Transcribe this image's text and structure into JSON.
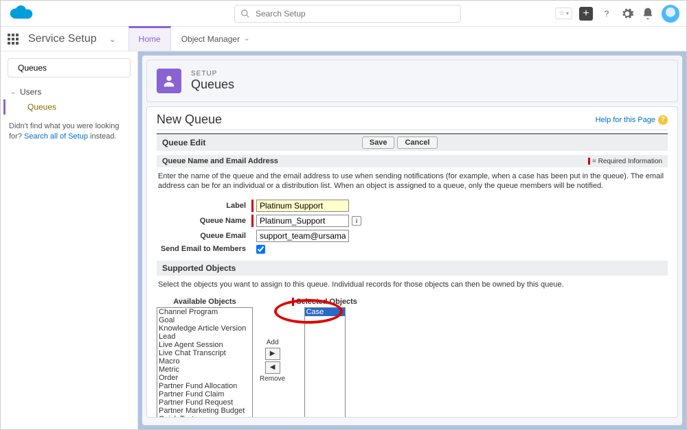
{
  "topbar": {
    "search_placeholder": "Search Setup"
  },
  "nav": {
    "app_name": "Service Setup",
    "tabs": [
      {
        "label": "Home",
        "active": true
      },
      {
        "label": "Object Manager",
        "active": false
      }
    ]
  },
  "sidebar": {
    "search_value": "Queues",
    "tree_parent": "Users",
    "tree_child": "Queues",
    "help_prefix": "Didn't find what you were looking for? ",
    "help_link": "Search all of Setup",
    "help_suffix": " instead."
  },
  "header": {
    "sup": "SETUP",
    "title": "Queues"
  },
  "page": {
    "title": "New Queue",
    "help_label": "Help for this Page",
    "edit_block_title": "Queue Edit",
    "save_btn": "Save",
    "cancel_btn": "Cancel",
    "name_section_title": "Queue Name and Email Address",
    "required_info": "= Required Information",
    "desc": "Enter the name of the queue and the email address to use when sending notifications (for example, when a case has been put in the queue). The email address can be for an individual or a distribution list. When an object is assigned to a queue, only the queue members will be notified.",
    "fields": {
      "label_label": "Label",
      "label_value": "Platinum Support",
      "qname_label": "Queue Name",
      "qname_value": "Platinum_Support",
      "qemail_label": "Queue Email",
      "qemail_value": "support_team@ursamajorso",
      "send_label": "Send Email to Members"
    },
    "supported_title": "Supported Objects",
    "supported_desc": "Select the objects you want to assign to this queue. Individual records for those objects can then be owned by this queue.",
    "available_label": "Available Objects",
    "selected_label": "Selected Objects",
    "add_label": "Add",
    "remove_label": "Remove",
    "available_objects": [
      "Channel Program",
      "Goal",
      "Knowledge Article Version",
      "Lead",
      "Live Agent Session",
      "Live Chat Transcript",
      "Macro",
      "Metric",
      "Order",
      "Partner Fund Allocation",
      "Partner Fund Claim",
      "Partner Fund Request",
      "Partner Marketing Budget",
      "Quick Text"
    ],
    "selected_objects": [
      "Case"
    ]
  }
}
